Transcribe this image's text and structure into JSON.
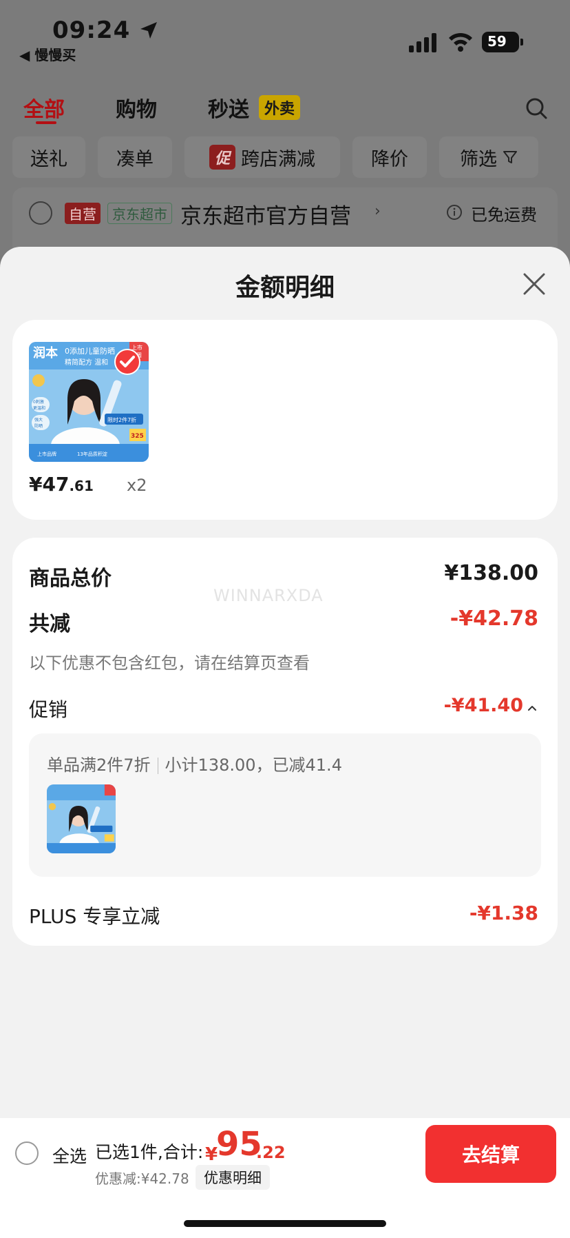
{
  "status_bar": {
    "time": "09:24",
    "back_app": "◀ 慢慢买",
    "battery": "59"
  },
  "top_tabs": [
    {
      "label": "全部"
    },
    {
      "label": "购物"
    },
    {
      "label": "秒送"
    }
  ],
  "waimai_tag": "外卖",
  "filters": {
    "gift": "送礼",
    "pool": "凑单",
    "promo_badge": "促",
    "cross_store": "跨店满减",
    "price_drop": "降价",
    "filter": "筛选"
  },
  "store": {
    "badge_self": "自营",
    "badge_market": "京东超市",
    "name": "京东超市官方自营",
    "chevron": "›",
    "shipping": "已免运费"
  },
  "sheet": {
    "title": "金额明细"
  },
  "product": {
    "price_int": "¥47",
    "price_dec": ".61",
    "qty": "x2",
    "image_text": {
      "brand": "润本",
      "headline1": "0添加儿童防晒",
      "headline2": "精简配方 温和",
      "corner": "上市",
      "corner2": "1周",
      "badge1": "0刺激",
      "badge2": "更温和",
      "badge3": "强大",
      "badge4": "防晒",
      "promo": "限时2件7折",
      "price": "325",
      "foot1": "上市品牌",
      "foot2": "13年品质积淀"
    }
  },
  "detail": {
    "total_label": "商品总价",
    "total_value": "¥138.00",
    "reduce_label": "共减",
    "reduce_value": "-¥42.78",
    "note": "以下优惠不包含红包，请在结算页查看",
    "promo_label": "促销",
    "promo_value": "-¥41.40",
    "promo_rule": "单品满2件7折",
    "promo_subtotal": "小计138.00，已减41.4",
    "plus_label": "PLUS 专享立减",
    "plus_value": "-¥1.38"
  },
  "watermark": "WINNARXDA",
  "bottom": {
    "select_all": "全选",
    "selected": "已选1件,合计:",
    "total_yen": "¥",
    "total_int": "95",
    "total_dec": ".22",
    "discount": "优惠减:¥42.78",
    "detail_chip": "优惠明细",
    "checkout": "去结算"
  },
  "colors": {
    "accent_red": "#e4382c",
    "checkout_red": "#f23030",
    "sheet_bg": "#f2f2f2"
  },
  "icons": [
    "nav-arrow-icon",
    "signal-icon",
    "wifi-icon",
    "battery-icon",
    "search-icon",
    "filter-icon",
    "info-icon",
    "close-icon",
    "check-icon",
    "chevron-up-icon"
  ]
}
